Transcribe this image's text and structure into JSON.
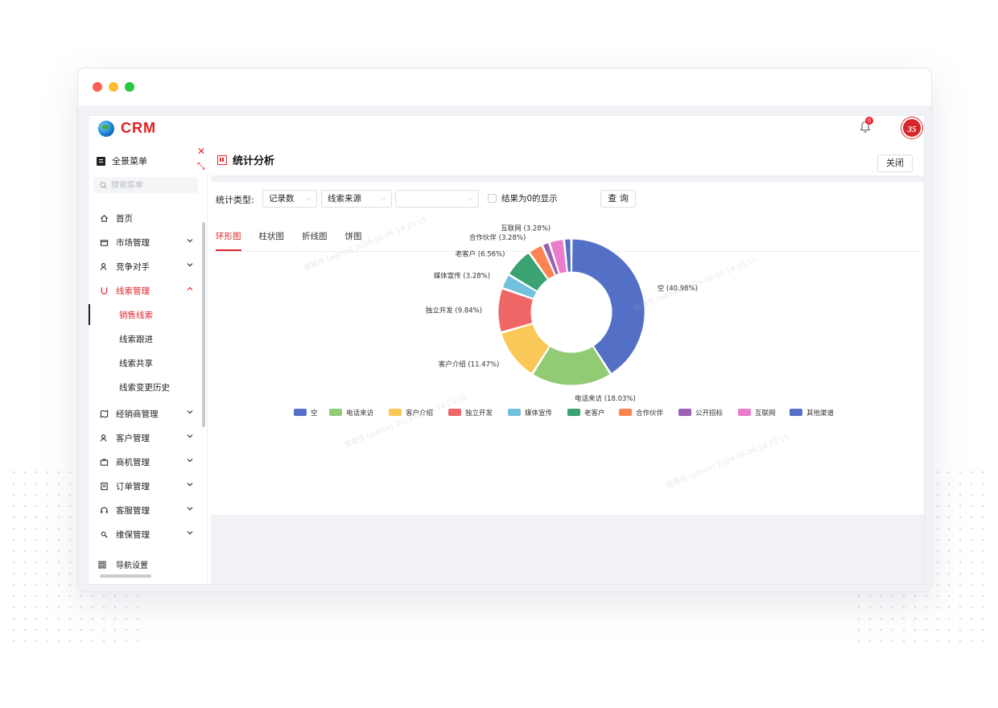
{
  "app": {
    "name": "CRM",
    "notification_count": "0",
    "avatar_text": "35"
  },
  "sidebar": {
    "menu_all": "全景菜单",
    "search_placeholder": "搜索菜单",
    "items": [
      {
        "label": "首页"
      },
      {
        "label": "市场管理"
      },
      {
        "label": "竞争对手"
      },
      {
        "label": "线索管理"
      },
      {
        "label": "经销商管理"
      },
      {
        "label": "客户管理"
      },
      {
        "label": "商机管理"
      },
      {
        "label": "订单管理"
      },
      {
        "label": "客服管理"
      },
      {
        "label": "维保管理"
      }
    ],
    "sub_items": [
      {
        "label": "销售线索"
      },
      {
        "label": "线索跟进"
      },
      {
        "label": "线索共享"
      },
      {
        "label": "线索变更历史"
      }
    ],
    "nav_setting": "导航设置"
  },
  "panel": {
    "title": "统计分析",
    "close_label": "关闭",
    "filter": {
      "label": "统计类型:",
      "select1": "记录数",
      "select2": "线索来源",
      "select3": "",
      "checkbox_label": "结果为0的显示",
      "query_label": "查 询"
    },
    "tabs": [
      {
        "label": "环形图"
      },
      {
        "label": "柱状图"
      },
      {
        "label": "折线图"
      },
      {
        "label": "饼图"
      }
    ]
  },
  "colors": {
    "accent": "#e0262c"
  },
  "watermark": "管理员 (admin) 2024-06-06 14:23:15",
  "chart_data": {
    "type": "pie",
    "donut": true,
    "series": [
      {
        "name": "空",
        "value": 40.98,
        "label": "空 (40.98%)",
        "color": "#5470c6"
      },
      {
        "name": "电话来访",
        "value": 18.03,
        "label": "电话来访 (18.03%)",
        "color": "#91cc75"
      },
      {
        "name": "客户介绍",
        "value": 11.47,
        "label": "客户介绍 (11.47%)",
        "color": "#fac858"
      },
      {
        "name": "独立开发",
        "value": 9.84,
        "label": "独立开发 (9.84%)",
        "color": "#ee6666"
      },
      {
        "name": "媒体宣传",
        "value": 3.28,
        "label": "媒体宣传 (3.28%)",
        "color": "#73c0de"
      },
      {
        "name": "老客户",
        "value": 6.56,
        "label": "老客户 (6.56%)",
        "color": "#3ba272"
      },
      {
        "name": "合作伙伴",
        "value": 3.28,
        "label": "合作伙伴 (3.28%)",
        "color": "#fc8452"
      },
      {
        "name": "公开招标",
        "value": 1.64,
        "label": "",
        "color": "#9a60b4"
      },
      {
        "name": "互联网",
        "value": 3.28,
        "label": "互联网 (3.28%)",
        "color": "#ea7ccc"
      },
      {
        "name": "其他渠道",
        "value": 1.64,
        "label": "",
        "color": "#5470c6"
      }
    ],
    "legend": "bottom"
  }
}
